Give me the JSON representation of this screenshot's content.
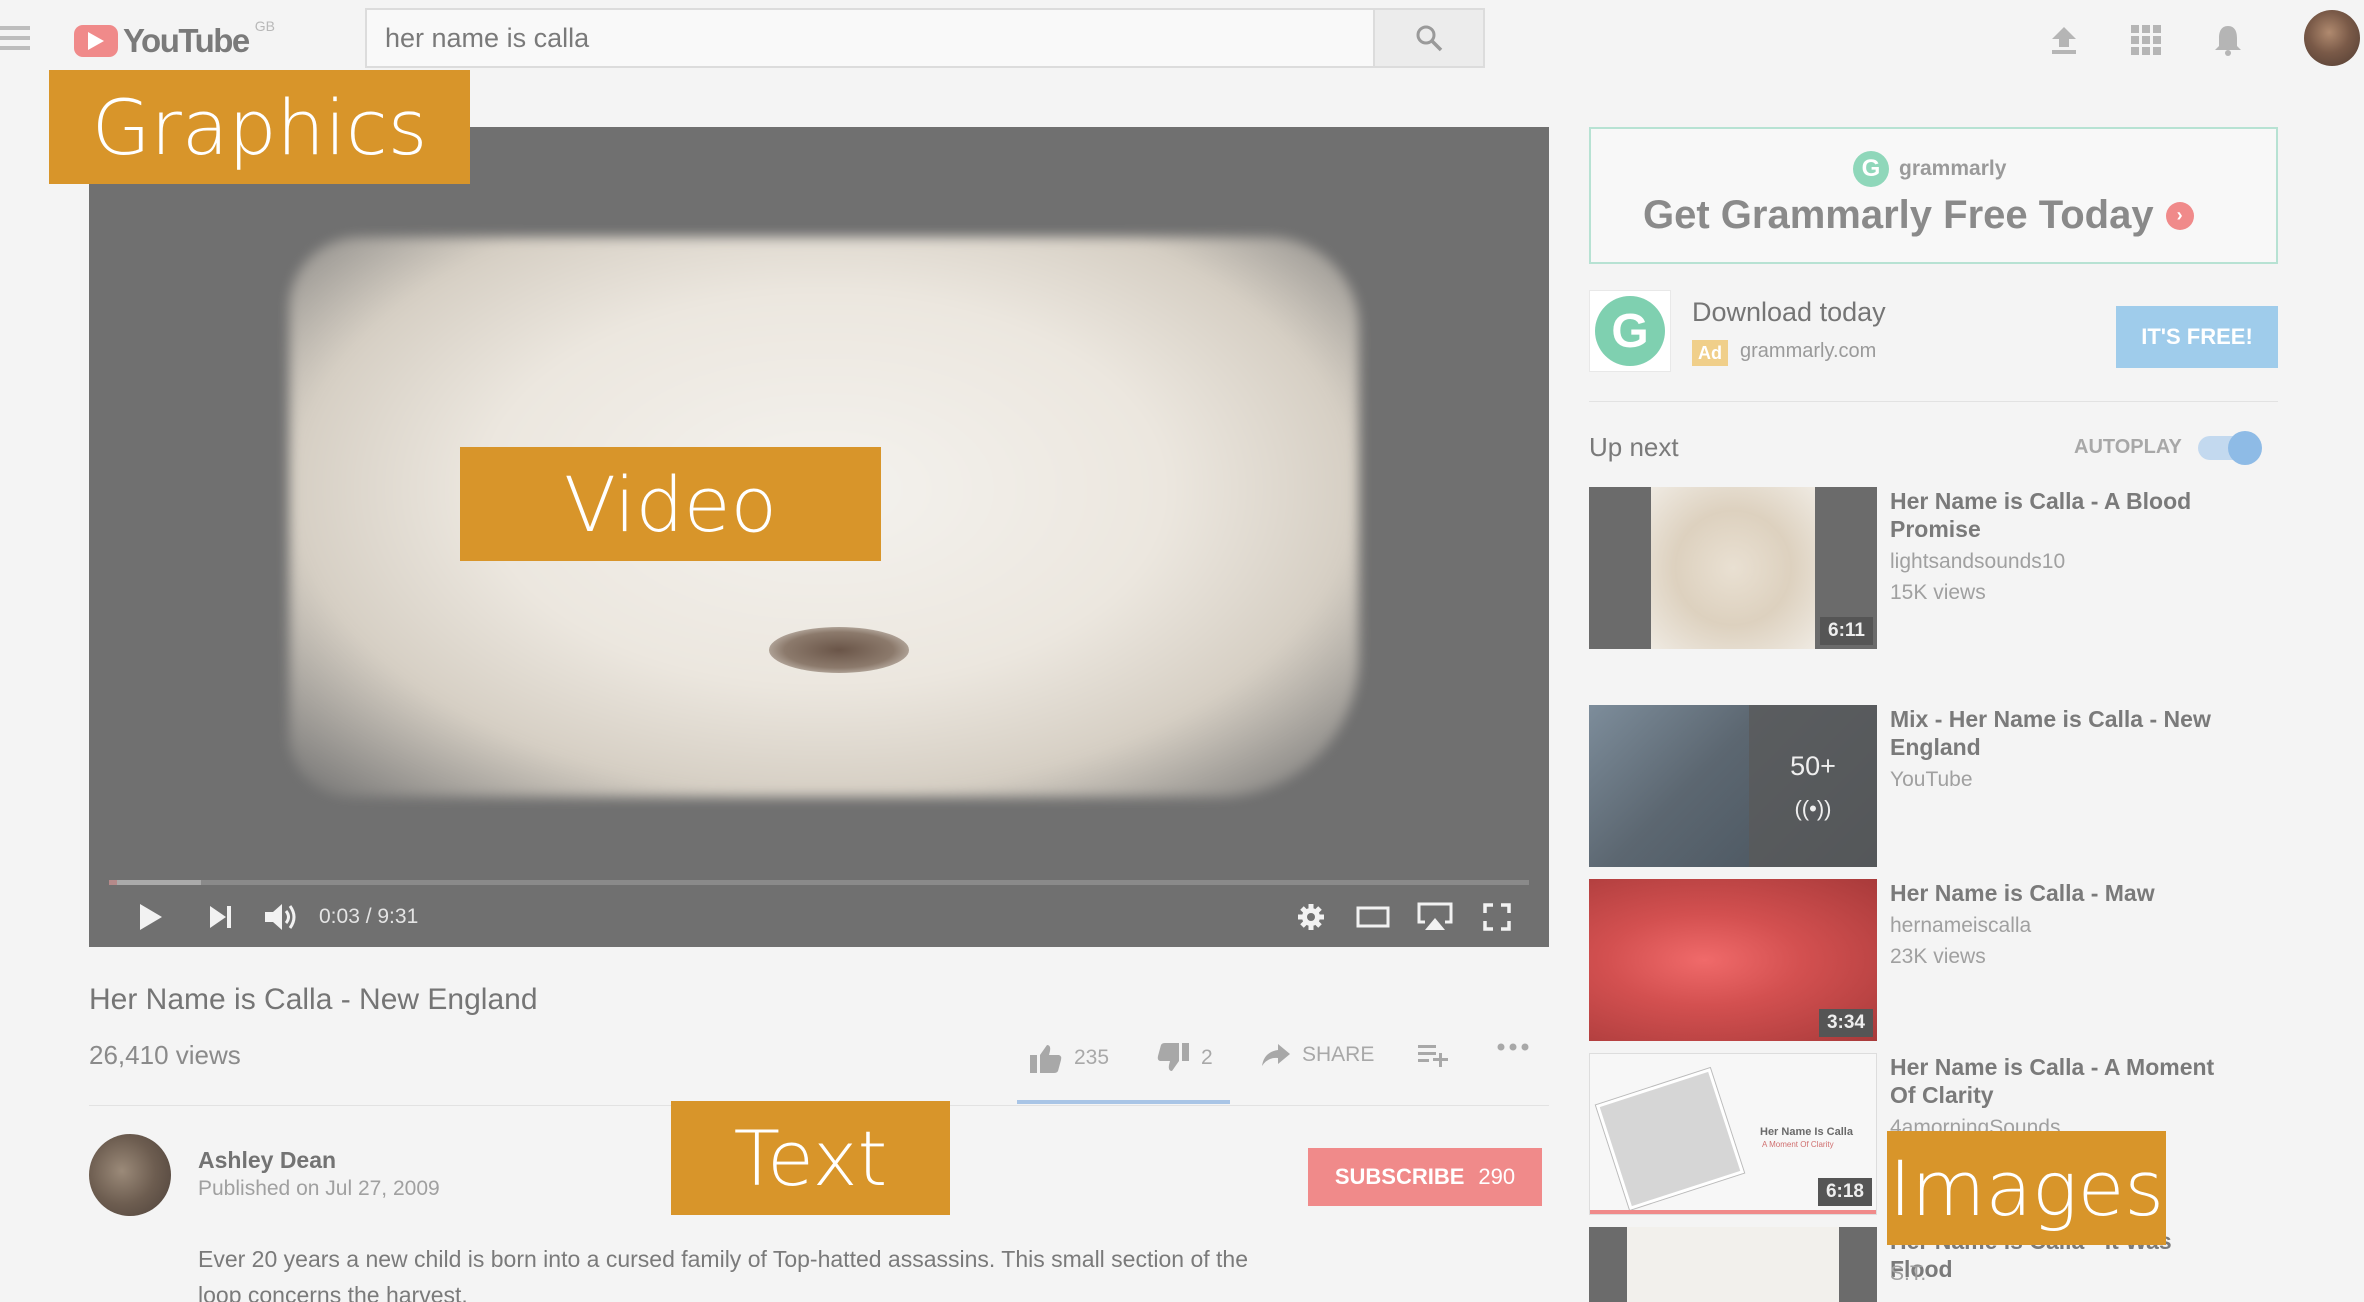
{
  "header": {
    "logo_text": "YouTube",
    "region": "GB",
    "search_value": "her name is calla"
  },
  "labels": {
    "graphics": "Graphics",
    "video": "Video",
    "text": "Text",
    "images": "Images"
  },
  "player": {
    "time": "0:03 / 9:31",
    "progress_fraction": 0.0053
  },
  "video": {
    "title": "Her Name is Calla - New England",
    "views": "26,410 views",
    "likes": "235",
    "dislikes": "2",
    "share_label": "SHARE"
  },
  "channel": {
    "name": "Ashley Dean",
    "published": "Published on Jul 27, 2009",
    "subscribe_label": "SUBSCRIBE",
    "subscriber_count": "290",
    "description": "Ever 20 years a new child is born into a cursed family of Top-hatted assassins. This small section of the loop concerns the harvest."
  },
  "ad": {
    "brand": "grammarly",
    "headline": "Get Grammarly Free Today",
    "title": "Download today",
    "tag": "Ad",
    "domain": "grammarly.com",
    "cta": "IT'S FREE!"
  },
  "up_next": {
    "title": "Up next",
    "autoplay_label": "AUTOPLAY",
    "items": [
      {
        "title": "Her Name is Calla - A Blood Promise",
        "channel": "lightsandsounds10",
        "views": "15K views",
        "duration": "6:11"
      },
      {
        "title": "Mix - Her Name is Calla - New England",
        "channel": "YouTube",
        "views": "",
        "mix_count": "50+"
      },
      {
        "title": "Her Name is Calla - Maw",
        "channel": "hernameiscalla",
        "views": "23K views",
        "duration": "3:34"
      },
      {
        "title": "Her Name is Calla - A Moment Of Clarity",
        "channel": "4amorningSounds",
        "views": "",
        "duration": "6:18",
        "thumb_caption": "Her Name Is Calla",
        "thumb_subcaption": "A Moment Of Clarity"
      },
      {
        "title": "Her Name is Calla - It Was Flood",
        "channel": "S.T.",
        "views": ""
      }
    ]
  },
  "colors": {
    "accent_orange": "#d8952a",
    "brand_red": "#f08a8a",
    "cta_blue": "#9fcceb"
  },
  "icons": [
    "menu-icon",
    "search-icon",
    "upload-icon",
    "apps-icon",
    "bell-icon",
    "play-icon",
    "next-icon",
    "volume-icon",
    "settings-icon",
    "theater-icon",
    "airplay-icon",
    "fullscreen-icon",
    "thumbs-up-icon",
    "thumbs-down-icon",
    "share-icon",
    "add-to-icon",
    "more-icon"
  ]
}
